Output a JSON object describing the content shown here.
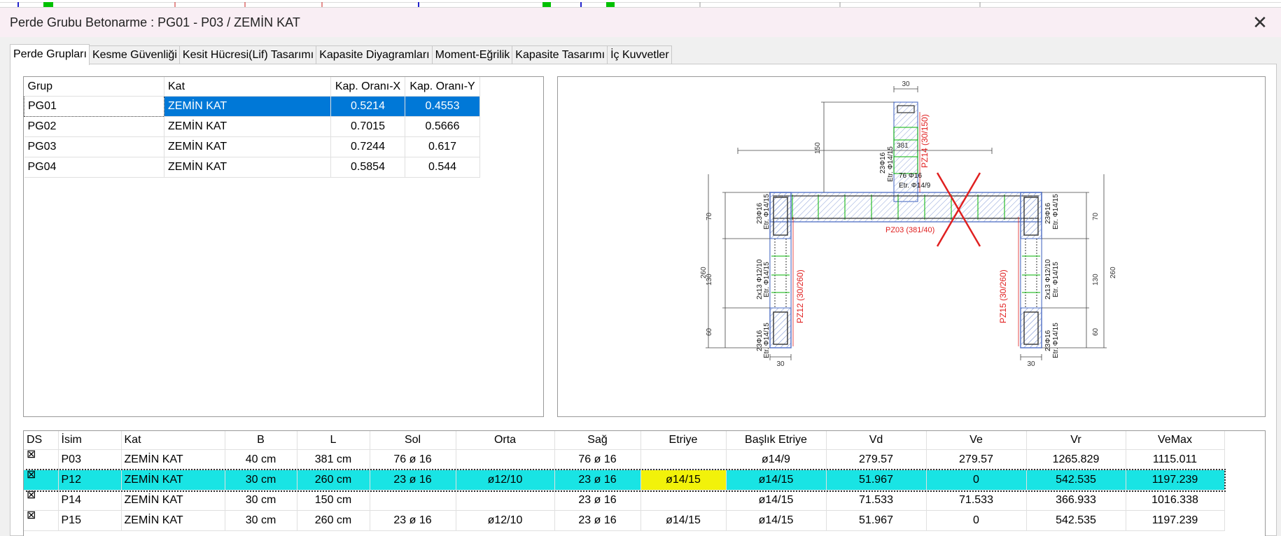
{
  "window": {
    "title": "Perde Grubu Betonarme  :  PG01 - P03 / ZEMİN KAT",
    "close": "✕"
  },
  "tabs": [
    {
      "label": "Perde Grupları",
      "active": true
    },
    {
      "label": "Kesme Güvenliği"
    },
    {
      "label": "Kesit Hücresi(Lif) Tasarımı"
    },
    {
      "label": "Kapasite Diyagramları"
    },
    {
      "label": "Moment-Eğrilik"
    },
    {
      "label": "Kapasite Tasarımı"
    },
    {
      "label": "İç Kuvvetler"
    }
  ],
  "groups_table": {
    "headers": [
      "Grup",
      "Kat",
      "Kap. Oranı-X",
      "Kap. Oranı-Y"
    ],
    "rows": [
      {
        "grup": "PG01",
        "kat": "ZEMİN KAT",
        "x": "0.5214",
        "y": "0.4553",
        "selected": true
      },
      {
        "grup": "PG02",
        "kat": "ZEMİN KAT",
        "x": "0.7015",
        "y": "0.5666"
      },
      {
        "grup": "PG03",
        "kat": "ZEMİN KAT",
        "x": "0.7244",
        "y": "0.617"
      },
      {
        "grup": "PG04",
        "kat": "ZEMİN KAT",
        "x": "0.5854",
        "y": "0.544"
      }
    ]
  },
  "drawing": {
    "dim_top": "30",
    "dim_150": "150",
    "dim_381": "381",
    "dim_70": "70",
    "dim_130": "130",
    "dim_260": "260",
    "dim_60": "60",
    "dim_bottom": "30",
    "p14_label": "PZ14 (30/150)",
    "p14_rebar": "23Φ16",
    "p14_etr": "Etr. Φ14/15",
    "p03_rebar": "76 Φ16",
    "p03_etr": "Etr. Φ14/9",
    "p03_label": "PZ03 (381/40)",
    "p12_label": "PZ12 (30/260)",
    "p15_label": "PZ15 (30/260)",
    "end_rebar": "23Φ16",
    "end_etr": "Etr. Φ14/15",
    "mid_rebar": "2x13 Φ12/10",
    "mid_etr": "Etr. Φ14/15",
    "colors": {
      "wall": "#5a78c8",
      "hatch": "#7a92d2",
      "red": "#e02020",
      "green": "#00b000",
      "dim": "#444444"
    }
  },
  "piers_table": {
    "headers": [
      "DS",
      "İsim",
      "Kat",
      "B",
      "L",
      "Sol",
      "Orta",
      "Sağ",
      "Etriye",
      "Başlık Etriye",
      "Vd",
      "Ve",
      "Vr",
      "VeMax"
    ],
    "rows": [
      {
        "ds": "⊠",
        "isim": "P03",
        "kat": "ZEMİN KAT",
        "b": "40 cm",
        "l": "381 cm",
        "sol": "76 ø 16",
        "orta": "",
        "sag": "76 ø 16",
        "etriye": "",
        "baslik": "ø14/9",
        "vd": "279.57",
        "ve": "279.57",
        "vr": "1265.829",
        "vemax": "1115.011"
      },
      {
        "ds": "⊠",
        "isim": "P12",
        "kat": "ZEMİN KAT",
        "b": "30 cm",
        "l": "260 cm",
        "sol": "23 ø 16",
        "orta": "ø12/10",
        "sag": "23 ø 16",
        "etriye": "ø14/15",
        "baslik": "ø14/15",
        "vd": "51.967",
        "ve": "0",
        "vr": "542.535",
        "vemax": "1197.239",
        "highlighted": true
      },
      {
        "ds": "⊠",
        "isim": "P14",
        "kat": "ZEMİN KAT",
        "b": "30 cm",
        "l": "150 cm",
        "sol": "",
        "orta": "",
        "sag": "23 ø 16",
        "etriye": "",
        "baslik": "ø14/15",
        "vd": "71.533",
        "ve": "71.533",
        "vr": "366.933",
        "vemax": "1016.338"
      },
      {
        "ds": "⊠",
        "isim": "P15",
        "kat": "ZEMİN KAT",
        "b": "30 cm",
        "l": "260 cm",
        "sol": "23 ø 16",
        "orta": "ø12/10",
        "sag": "23 ø 16",
        "etriye": "ø14/15",
        "baslik": "ø14/15",
        "vd": "51.967",
        "ve": "0",
        "vr": "542.535",
        "vemax": "1197.239"
      }
    ]
  }
}
